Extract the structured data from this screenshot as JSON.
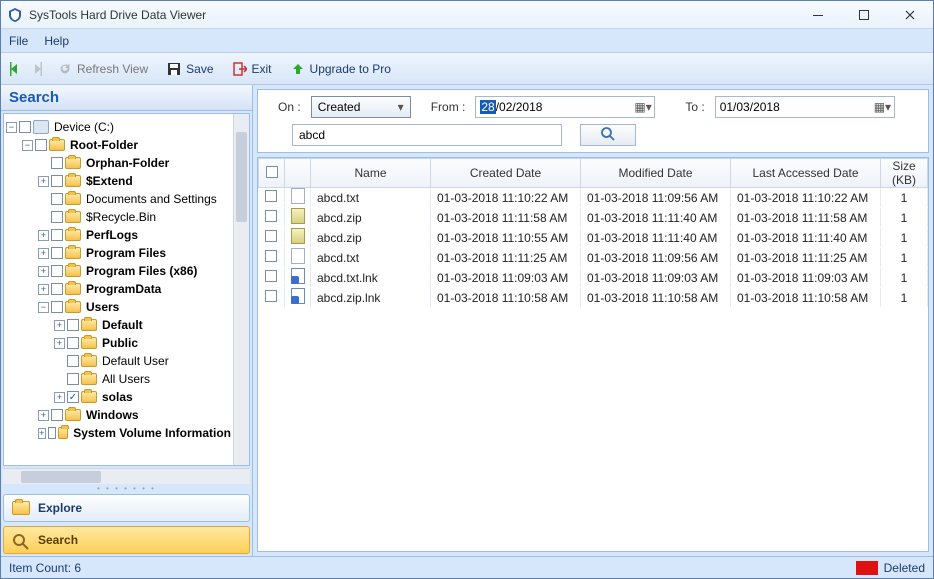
{
  "window": {
    "title": "SysTools Hard Drive Data Viewer"
  },
  "menu": {
    "file": "File",
    "help": "Help"
  },
  "toolbar": {
    "refresh": "Refresh View",
    "save": "Save",
    "exit": "Exit",
    "upgrade": "Upgrade to Pro"
  },
  "left": {
    "search_header": "Search",
    "explore_tab": "Explore",
    "search_tab": "Search"
  },
  "tree": {
    "root": "Device (C:)",
    "items": [
      "Root-Folder",
      "Orphan-Folder",
      "$Extend",
      "Documents and Settings",
      "$Recycle.Bin",
      "PerfLogs",
      "Program Files",
      "Program Files (x86)",
      "ProgramData",
      "Users",
      "Default",
      "Public",
      "Default User",
      "All Users",
      "solas",
      "Windows",
      "System Volume Information"
    ]
  },
  "filter": {
    "on_label": "On :",
    "on_value": "Created",
    "from_label": "From :",
    "from_day": "28",
    "from_rest": "/02/2018",
    "to_label": "To :",
    "to_value": "01/03/2018",
    "text": "abcd"
  },
  "grid": {
    "cols": {
      "name": "Name",
      "created": "Created Date",
      "modified": "Modified Date",
      "accessed": "Last Accessed Date",
      "size": "Size (KB)"
    },
    "rows": [
      {
        "icon": "txt",
        "name": "abcd.txt",
        "created": "01-03-2018 11:10:22 AM",
        "modified": "01-03-2018 11:09:56 AM",
        "accessed": "01-03-2018 11:10:22 AM",
        "size": "1"
      },
      {
        "icon": "zip",
        "name": "abcd.zip",
        "created": "01-03-2018 11:11:58 AM",
        "modified": "01-03-2018 11:11:40 AM",
        "accessed": "01-03-2018 11:11:58 AM",
        "size": "1"
      },
      {
        "icon": "zip",
        "name": "abcd.zip",
        "created": "01-03-2018 11:10:55 AM",
        "modified": "01-03-2018 11:11:40 AM",
        "accessed": "01-03-2018 11:11:40 AM",
        "size": "1"
      },
      {
        "icon": "txt",
        "name": "abcd.txt",
        "created": "01-03-2018 11:11:25 AM",
        "modified": "01-03-2018 11:09:56 AM",
        "accessed": "01-03-2018 11:11:25 AM",
        "size": "1"
      },
      {
        "icon": "lnk",
        "name": "abcd.txt.lnk",
        "created": "01-03-2018 11:09:03 AM",
        "modified": "01-03-2018 11:09:03 AM",
        "accessed": "01-03-2018 11:09:03 AM",
        "size": "1"
      },
      {
        "icon": "lnk",
        "name": "abcd.zip.lnk",
        "created": "01-03-2018 11:10:58 AM",
        "modified": "01-03-2018 11:10:58 AM",
        "accessed": "01-03-2018 11:10:58 AM",
        "size": "1"
      }
    ]
  },
  "status": {
    "item_count": "Item Count: 6",
    "deleted": "Deleted"
  }
}
